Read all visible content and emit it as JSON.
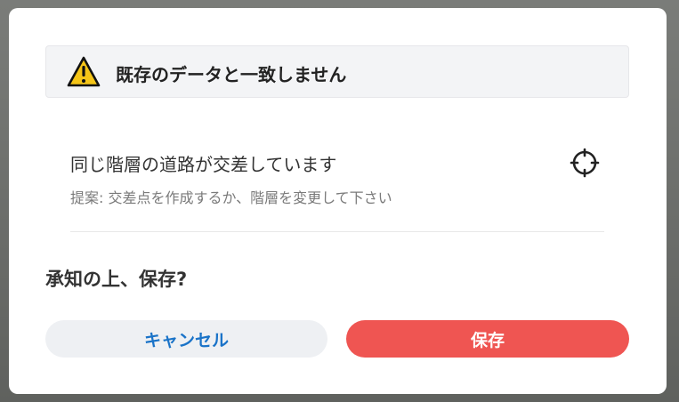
{
  "dialog": {
    "warning": {
      "icon": "warning-triangle-icon",
      "title": "既存のデータと一致しません"
    },
    "issue": {
      "title": "同じ階層の道路が交差しています",
      "suggestion": "提案: 交差点を作成するか、階層を変更して下さい",
      "locate_icon": "crosshair-locate-icon"
    },
    "question": "承知の上、保存?",
    "buttons": {
      "cancel_label": "キャンセル",
      "save_label": "保存"
    }
  },
  "colors": {
    "accent_blue": "#1a73c8",
    "save_red": "#ef5552",
    "warning_yellow": "#f5c518"
  }
}
